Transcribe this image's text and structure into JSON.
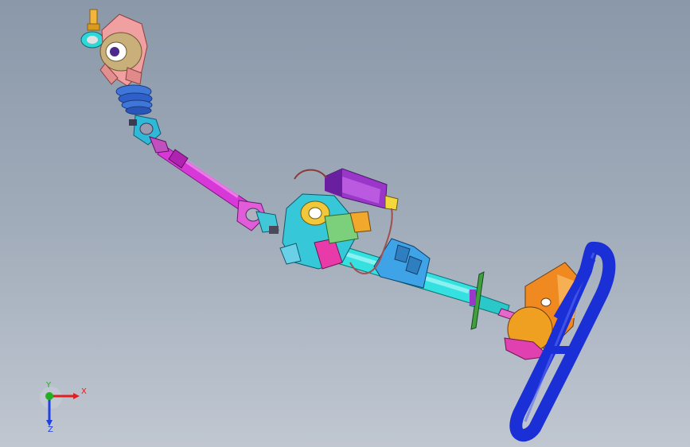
{
  "viewport": {
    "background_top": "#8a98a9",
    "background_bottom": "#c0c7d1"
  },
  "model": {
    "name": "steering-column-assembly",
    "parts": [
      {
        "id": "tie-rod-end",
        "color": "#f2b63a"
      },
      {
        "id": "steering-gear-housing",
        "color": "#f0a0a0"
      },
      {
        "id": "rubber-boot",
        "color": "#3f77d8"
      },
      {
        "id": "lower-universal-joint",
        "color": "#2fb8d8"
      },
      {
        "id": "intermediate-shaft",
        "color": "#d838d8"
      },
      {
        "id": "upper-universal-joint",
        "color": "#e05cd8"
      },
      {
        "id": "eps-motor-gearbox",
        "color": "#36c8d8"
      },
      {
        "id": "ecu-module",
        "color": "#9a36c8"
      },
      {
        "id": "control-board",
        "color": "#7cd07c"
      },
      {
        "id": "column-tube",
        "color": "#35e0e0"
      },
      {
        "id": "mounting-bracket",
        "color": "#3fa3e8"
      },
      {
        "id": "flange-plate",
        "color": "#3fa040"
      },
      {
        "id": "steering-wheel-hub",
        "color": "#f08a20"
      },
      {
        "id": "steering-wheel-rim",
        "color": "#1a2fd6"
      }
    ]
  },
  "triad": {
    "x_label": "X",
    "y_label": "Y",
    "z_label": "Z",
    "x_color": "#e02020",
    "y_color": "#20b020",
    "z_color": "#2040e0"
  }
}
